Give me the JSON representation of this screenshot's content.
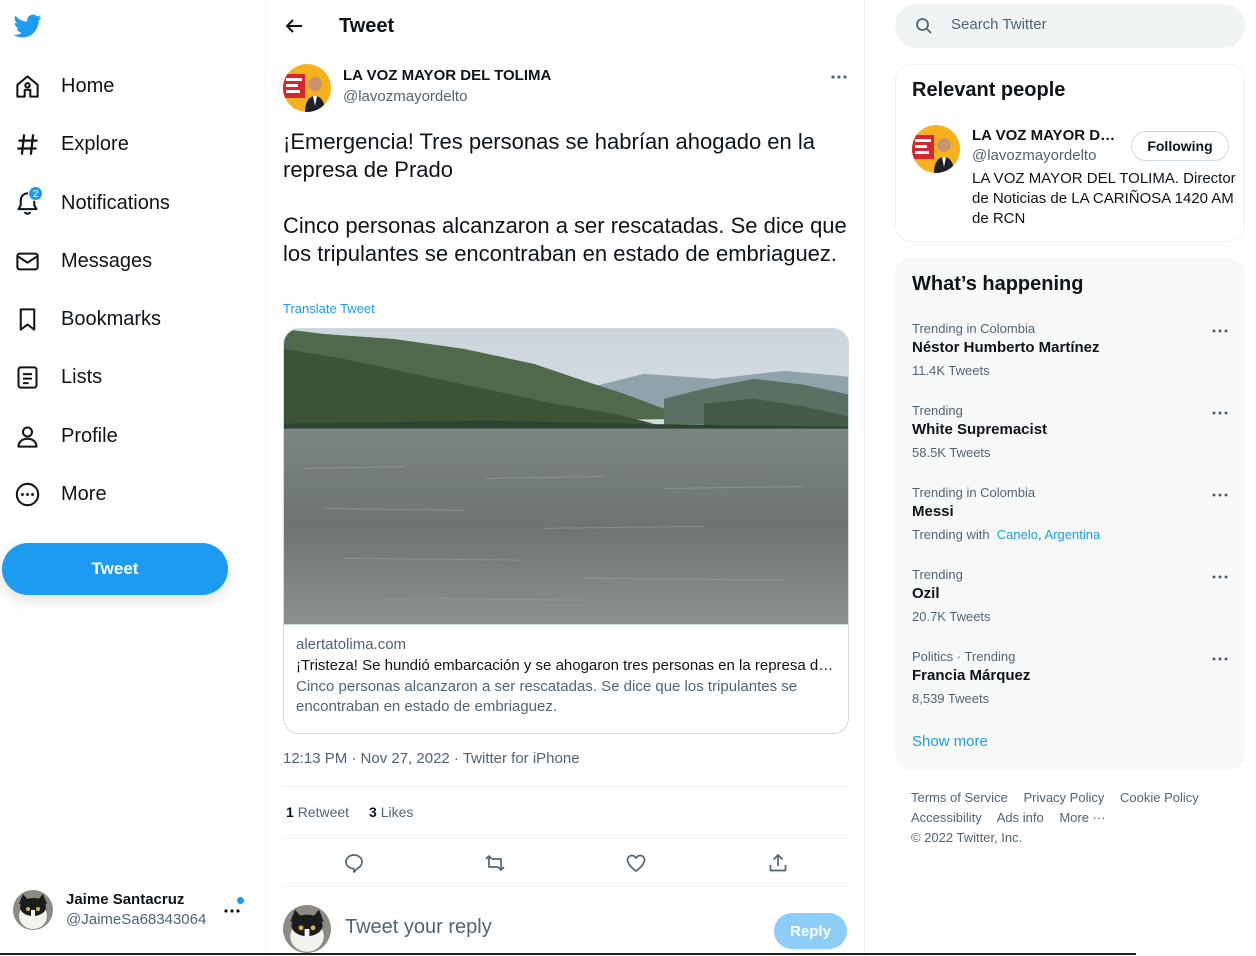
{
  "nav": {
    "items": [
      {
        "label": "Home",
        "icon": "home-icon"
      },
      {
        "label": "Explore",
        "icon": "hashtag-icon"
      },
      {
        "label": "Notifications",
        "icon": "bell-icon",
        "badge": "2"
      },
      {
        "label": "Messages",
        "icon": "envelope-icon"
      },
      {
        "label": "Bookmarks",
        "icon": "bookmark-icon"
      },
      {
        "label": "Lists",
        "icon": "list-icon"
      },
      {
        "label": "Profile",
        "icon": "person-icon"
      },
      {
        "label": "More",
        "icon": "more-circle-icon"
      }
    ],
    "tweet_button": "Tweet",
    "account": {
      "name": "Jaime Santacruz",
      "handle": "@JaimeSa68343064"
    }
  },
  "tweet": {
    "header_title": "Tweet",
    "author_name": "LA VOZ MAYOR DEL TOLIMA",
    "author_handle": "@lavozmayordelto",
    "text_1": "¡Emergencia! Tres personas se habrían ahogado en la represa de Prado",
    "text_2": "Cinco personas alcanzaron a ser rescatadas. Se dice que los tripulantes se encontraban en estado de embriaguez.",
    "translate": "Translate Tweet",
    "card": {
      "domain": "alertatolima.com",
      "title": "¡Tristeza! Se hundió embarcación y se ahogaron tres personas en la represa de Prado",
      "description": "Cinco personas alcanzaron a ser rescatadas. Se dice que los tripulantes se encontraban en estado de embriaguez."
    },
    "meta": "12:13 PM · Nov 27, 2022 · Twitter for iPhone",
    "retweets_count": "1",
    "retweets_label": "Retweet",
    "likes_count": "3",
    "likes_label": "Likes",
    "reply_placeholder": "Tweet your reply",
    "reply_button": "Reply"
  },
  "right": {
    "search_placeholder": "Search Twitter",
    "relevant": {
      "title": "Relevant people",
      "name": "LA VOZ MAYOR DEL TOLIMA",
      "handle": "@lavozmayordelto",
      "follow_label": "Following",
      "bio": "LA VOZ MAYOR DEL TOLIMA. Director de Noticias de LA CARIÑOSA 1420 AM de RCN"
    },
    "happening": {
      "title": "What’s happening",
      "trends": [
        {
          "context": "Trending in Colombia",
          "title": "Néstor Humberto Martínez",
          "count": "11.4K Tweets"
        },
        {
          "context": "Trending",
          "title": "White Supremacist",
          "count": "58.5K Tweets"
        },
        {
          "context": "Trending in Colombia",
          "title": "Messi",
          "with_label": "Trending with",
          "with_1": "Canelo",
          "with_sep": ",",
          "with_2": "Argentina"
        },
        {
          "context": "Trending",
          "title": "Ozil",
          "count": "20.7K Tweets"
        },
        {
          "context": "Politics · Trending",
          "title": "Francia Márquez",
          "count": "8,539 Tweets"
        }
      ],
      "show_more": "Show more"
    },
    "footer": {
      "links_1": [
        "Terms of Service",
        "Privacy Policy",
        "Cookie Policy"
      ],
      "links_2": [
        "Accessibility",
        "Ads info",
        "More ···"
      ],
      "copyright": "© 2022 Twitter, Inc."
    }
  },
  "colors": {
    "accent": "#1d9bf0",
    "text": "#0f1419",
    "muted": "#536471",
    "reply_disabled": "#8ecdf8"
  }
}
